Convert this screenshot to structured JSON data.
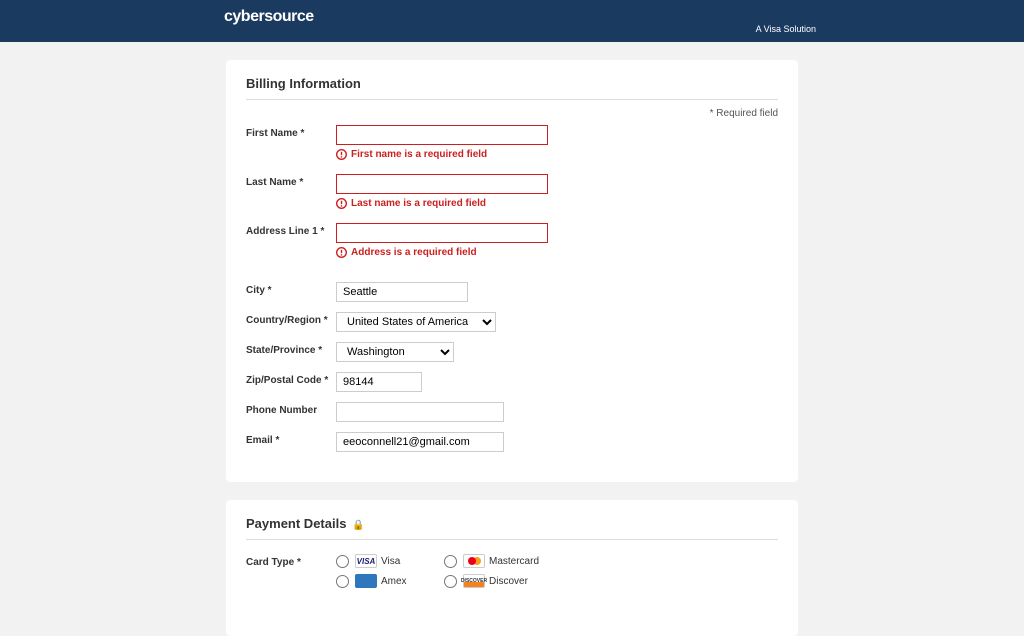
{
  "brand": {
    "name": "cybersource",
    "tagline": "A Visa Solution"
  },
  "billing": {
    "heading": "Billing Information",
    "required_note": "* Required field",
    "labels": {
      "first_name": "First Name *",
      "last_name": "Last Name *",
      "address1": "Address Line 1 *",
      "city": "City *",
      "country": "Country/Region *",
      "state": "State/Province *",
      "zip": "Zip/Postal Code *",
      "phone": "Phone Number",
      "email": "Email *"
    },
    "errors": {
      "first_name": "First name is a required field",
      "last_name": "Last name is a required field",
      "address1": "Address is a required field"
    },
    "values": {
      "first_name": "",
      "last_name": "",
      "address1": "",
      "city": "Seattle",
      "country": "United States of America",
      "state": "Washington",
      "zip": "98144",
      "phone": "",
      "email": "eeoconnell21@gmail.com"
    }
  },
  "payment": {
    "heading": "Payment Details",
    "labels": {
      "card_type": "Card Type *"
    },
    "types": {
      "visa": "Visa",
      "mastercard": "Mastercard",
      "amex": "Amex",
      "discover": "Discover"
    }
  }
}
